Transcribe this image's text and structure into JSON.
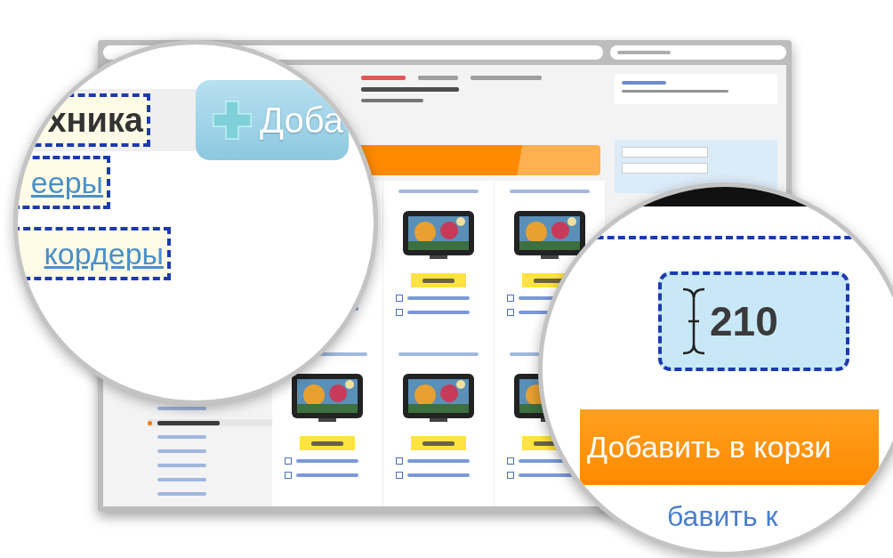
{
  "sidebar": {
    "items": [
      {
        "selected": false
      },
      {
        "selected": true
      },
      {
        "selected": false
      },
      {
        "selected": false
      },
      {
        "selected": false
      },
      {
        "selected": false
      },
      {
        "selected": false
      }
    ]
  },
  "products": [
    {
      "kind": "covered"
    },
    {
      "kind": "picture"
    },
    {
      "kind": "picture"
    },
    {
      "kind": "picture"
    },
    {
      "kind": "picture"
    },
    {
      "kind": "picture"
    }
  ],
  "left_magnifier": {
    "category": "хника",
    "links": [
      "ееры",
      "кордеры"
    ],
    "add_button": "Доба"
  },
  "right_magnifier": {
    "quantity": "210",
    "cart_button": "Добавить в корзи",
    "link": "бавить к"
  }
}
